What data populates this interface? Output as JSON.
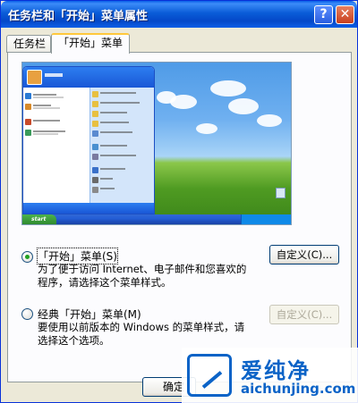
{
  "window": {
    "title": "任务栏和「开始」菜单属性"
  },
  "titlebar": {
    "help_glyph": "?",
    "close_glyph": "✕"
  },
  "tabs": [
    {
      "label": "任务栏"
    },
    {
      "label": "「开始」菜单",
      "active": true
    }
  ],
  "preview": {
    "start_label": "start"
  },
  "options": [
    {
      "label": "「开始」菜单(S)",
      "selected": true,
      "description": "为了便于访问 Internet、电子邮件和您喜欢的程序，请选择这个菜单样式。",
      "button_label": "自定义(C)...",
      "button_enabled": true
    },
    {
      "label": "经典「开始」菜单(M)",
      "selected": false,
      "description": "要使用以前版本的 Windows 的菜单样式，请选择这个选项。",
      "button_label": "自定义(C)...",
      "button_enabled": false
    }
  ],
  "footer": {
    "ok_label": "确定"
  },
  "watermark": {
    "title": "爱纯净",
    "url": "aichunjing.com"
  },
  "colors": {
    "title_bar": "#0a5cd8",
    "accent_radio": "#21a121",
    "watermark": "#0b63c7"
  }
}
